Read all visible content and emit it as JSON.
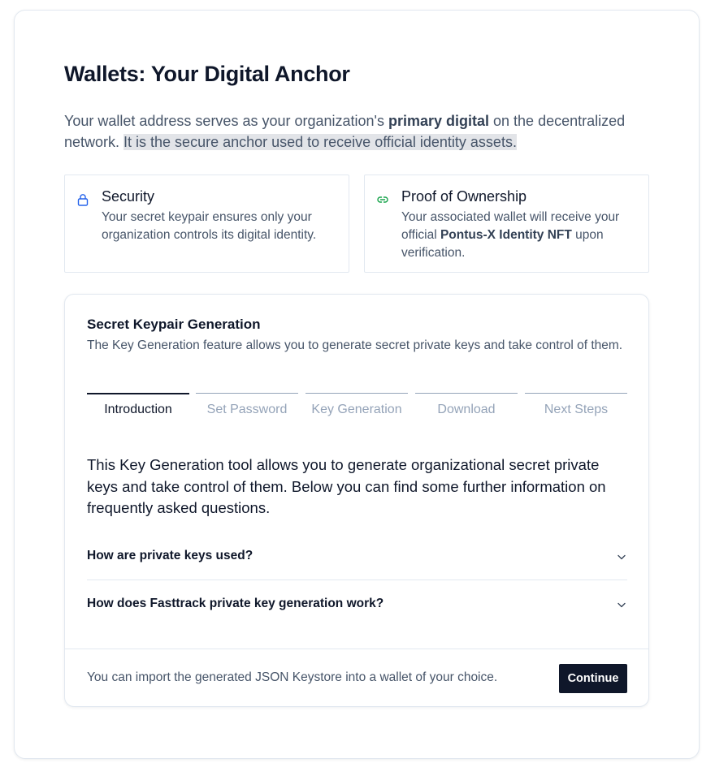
{
  "page": {
    "title": "Wallets: Your Digital Anchor",
    "intro": {
      "part1": "Your wallet address serves as your organization's ",
      "bold": "primary digital",
      "part2": " on the decentralized network. ",
      "highlight": "It is the secure anchor used to receive official identity assets."
    }
  },
  "features": {
    "security": {
      "title": "Security",
      "description": "Your secret keypair ensures only your organization controls its digital identity.",
      "icon": "lock-icon",
      "icon_color": "#2563eb"
    },
    "ownership": {
      "title": "Proof of Ownership",
      "desc_part1": "Your associated wallet will receive your official ",
      "desc_bold": "Pontus-X Identity NFT",
      "desc_part2": " upon verification.",
      "icon": "link-icon",
      "icon_color": "#16a34a"
    }
  },
  "keypair": {
    "title": "Secret Keypair Generation",
    "description": "The Key Generation feature allows you to generate secret private keys and take control of them.",
    "steps": [
      {
        "label": "Introduction",
        "active": true
      },
      {
        "label": "Set Password",
        "active": false
      },
      {
        "label": "Key Generation",
        "active": false
      },
      {
        "label": "Download",
        "active": false
      },
      {
        "label": "Next Steps",
        "active": false
      }
    ],
    "body": "This Key Generation tool allows you to generate organizational secret private keys and take control of them. Below you can find some further information on frequently asked questions.",
    "faq": [
      {
        "question": "How are private keys used?"
      },
      {
        "question": "How does Fasttrack private key generation work?"
      }
    ],
    "footer": {
      "note": "You can import the generated JSON Keystore into a wallet of your choice.",
      "continue_label": "Continue"
    }
  },
  "colors": {
    "primary": "#0f172a",
    "muted_text": "#475569",
    "border": "#e2e8f0",
    "inactive_step": "#94a3b8"
  }
}
